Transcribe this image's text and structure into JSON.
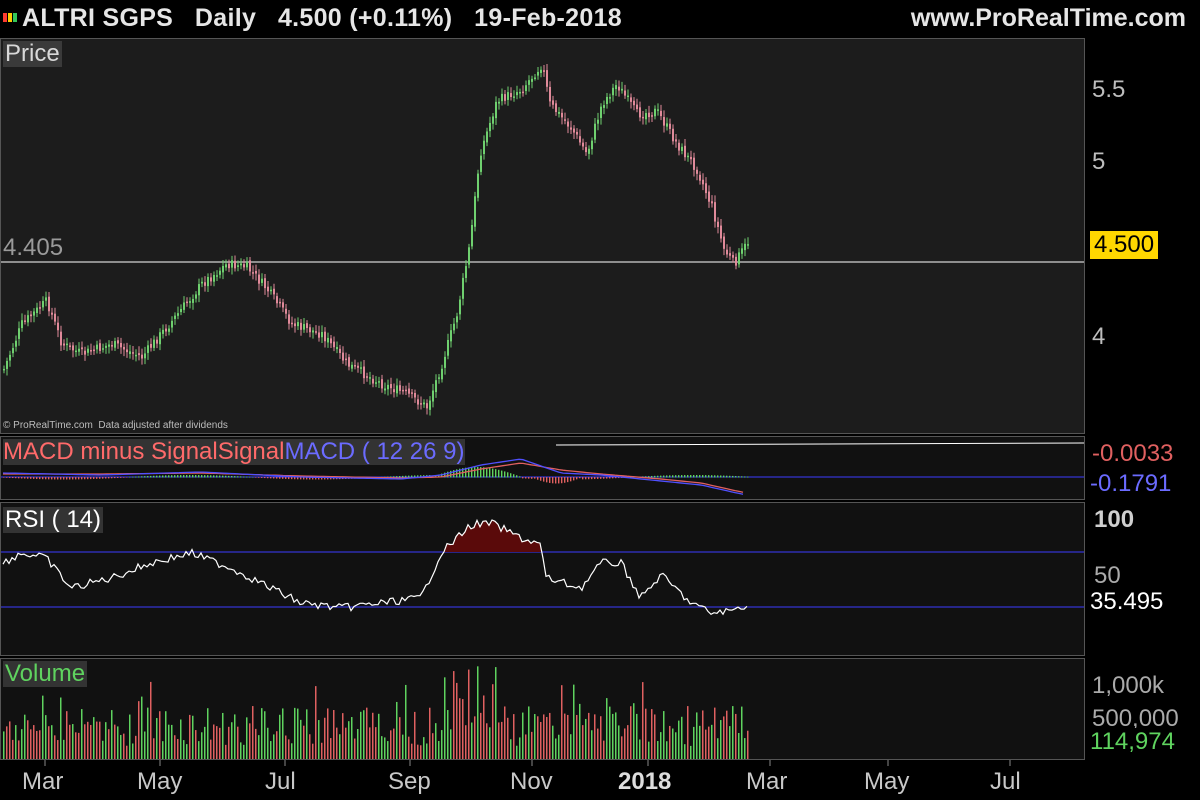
{
  "header": {
    "symbol": "ALTRI SGPS",
    "period": "Daily",
    "price": "4.500",
    "change": "(+0.11%)",
    "date": "19-Feb-2018",
    "website": "www.ProRealTime.com",
    "window_buttons": [
      "#ff3b30",
      "#ffcc00",
      "#34c759"
    ]
  },
  "price_panel": {
    "label": "Price",
    "line_value": "4.405",
    "current_badge": "4.500",
    "copyright": "© ProRealTime.com  Data adjusted after dividends",
    "axis_ticks": [
      "5.5",
      "5",
      "4"
    ],
    "colors": {
      "up": "#6fd06f",
      "down": "#e08a9a",
      "badge": "#ffd700"
    }
  },
  "macd_panel": {
    "label_minus": "MACD minus Signal",
    "label_signal": "Signal",
    "label_macd": "MACD ( 12 26 9)",
    "value_top": "-0.0033",
    "value_bottom": "-0.1791"
  },
  "rsi_panel": {
    "label": "RSI ( 14)",
    "axis_top": "100",
    "axis_mid": "50",
    "current": "35.495"
  },
  "volume_panel": {
    "label": "Volume",
    "axis_top": "1,000k",
    "axis_mid": "500,000",
    "current": "114,974"
  },
  "x_axis": {
    "labels": [
      "Mar",
      "May",
      "Jul",
      "Sep",
      "Nov",
      "2018",
      "Mar",
      "May",
      "Jul"
    ]
  }
}
